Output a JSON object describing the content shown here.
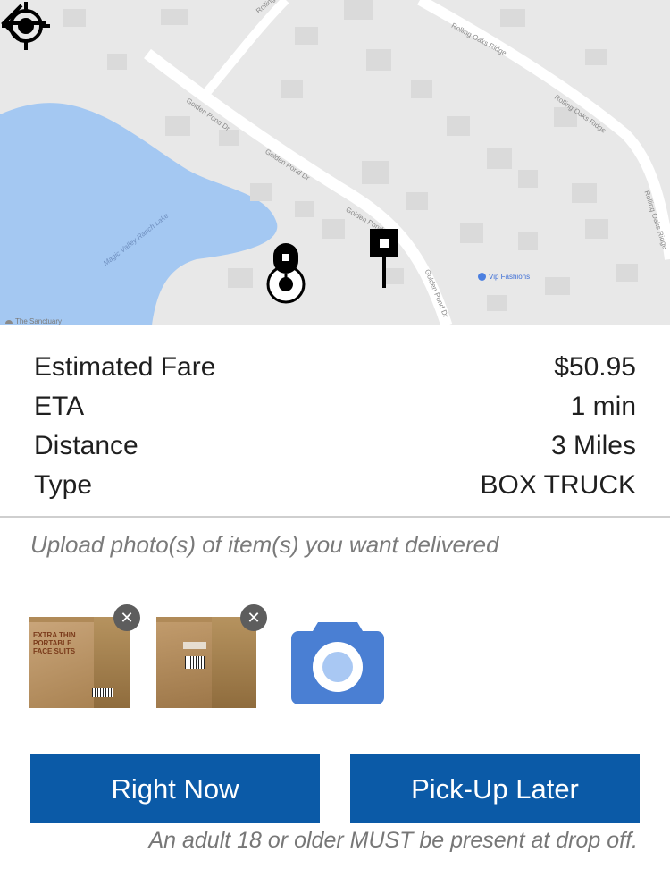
{
  "map": {
    "streets": [
      "Rolling Oaks Ridge",
      "Rolling Oaks Ridge",
      "Rolling Oaks Ridge",
      "Golden Pond Dr",
      "Golden Pond Dr",
      "Golden Pond Dr",
      "Golden Pond Dr",
      "Rolling Oa"
    ],
    "lake_label": "Magic Valley Ranch Lake",
    "poi_label": "Vip Fashions",
    "area_label": "The Sanctuary",
    "icons": [
      "back-arrow-icon",
      "my-location-icon",
      "pickup-pin-icon",
      "dropoff-flag-icon"
    ]
  },
  "details": {
    "rows": [
      {
        "label": "Estimated Fare",
        "value": "$50.95"
      },
      {
        "label": "ETA",
        "value": "1 min"
      },
      {
        "label": "Distance",
        "value": "3 Miles"
      },
      {
        "label": "Type",
        "value": "BOX TRUCK"
      }
    ]
  },
  "upload": {
    "label": "Upload photo(s) of item(s) you want delivered",
    "photos": [
      {
        "text": "EXTRA THIN\nPORTABLE\nFACE SUITS"
      },
      {
        "text": ""
      }
    ],
    "remove_symbol": "✕",
    "camera_icon": "camera-icon"
  },
  "actions": {
    "right_now": "Right Now",
    "pickup_later": "Pick-Up Later"
  },
  "notice": "An adult 18 or older MUST be present at drop off.",
  "colors": {
    "primary_button": "#0b5aa7",
    "camera_blue": "#4a7fd3",
    "map_water": "#a4c8f2",
    "map_land": "#e8e8e8"
  }
}
